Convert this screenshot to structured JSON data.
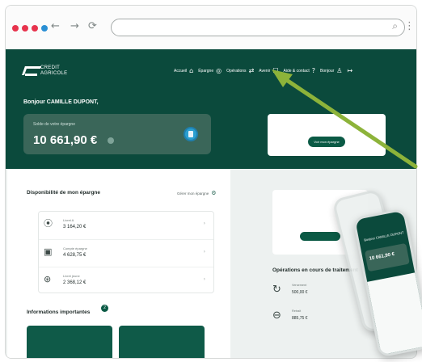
{
  "browser": {
    "dot_colors": [
      "#e7334d",
      "#e7334d",
      "#e7334d",
      "#2a8fd4"
    ],
    "nav": {
      "back": "←",
      "forward": "→",
      "reload": "⟳"
    },
    "search_icon": "⌕",
    "menu_icon": "⋮"
  },
  "app": {
    "logo_line1": "CREDIT",
    "logo_line2": "AGRICOLE",
    "nav": [
      {
        "label": "Accueil",
        "icon": "⌂"
      },
      {
        "label": "Épargne",
        "icon": "◎"
      },
      {
        "label": "Opérations",
        "icon": "⇄"
      },
      {
        "label": "Avenir",
        "icon": "☐"
      },
      {
        "label": "Aide & contact",
        "icon": "?"
      },
      {
        "label": "Bonjour",
        "icon": "♙"
      },
      {
        "label": "",
        "icon": "↦"
      }
    ],
    "greeting": "Bonjour CAMILLE DUPONT,",
    "balance": {
      "label": "Solde de votre épargne",
      "amount": "10 661,90 €"
    },
    "promo_button": "Voir mon épargne"
  },
  "savings": {
    "title": "Disponibilité de mon épargne",
    "link": "Gérer mon épargne",
    "accounts": [
      {
        "name": "Livret A",
        "balance": "3 164,20 €",
        "icon": "⦿"
      },
      {
        "name": "Compte épargne",
        "balance": "4 628,75 €",
        "icon": "▣"
      },
      {
        "name": "Livret jeune",
        "balance": "2 368,12 €",
        "icon": "⊛"
      }
    ]
  },
  "info": {
    "title": "Informations importantes",
    "badge": "2"
  },
  "ops": {
    "title": "Opérations en cours de traitement",
    "items": [
      {
        "name": "Versement",
        "amount": "500,00 €",
        "icon": "↻"
      },
      {
        "name": "Retrait",
        "amount": "885,75 €",
        "icon": "⊖"
      }
    ]
  },
  "phone": {
    "greeting": "Bonjour CAMILLE DUPONT",
    "amount": "10 661,90 €"
  },
  "colors": {
    "brand_green": "#0b4a3c",
    "arrow": "#8db33a"
  }
}
